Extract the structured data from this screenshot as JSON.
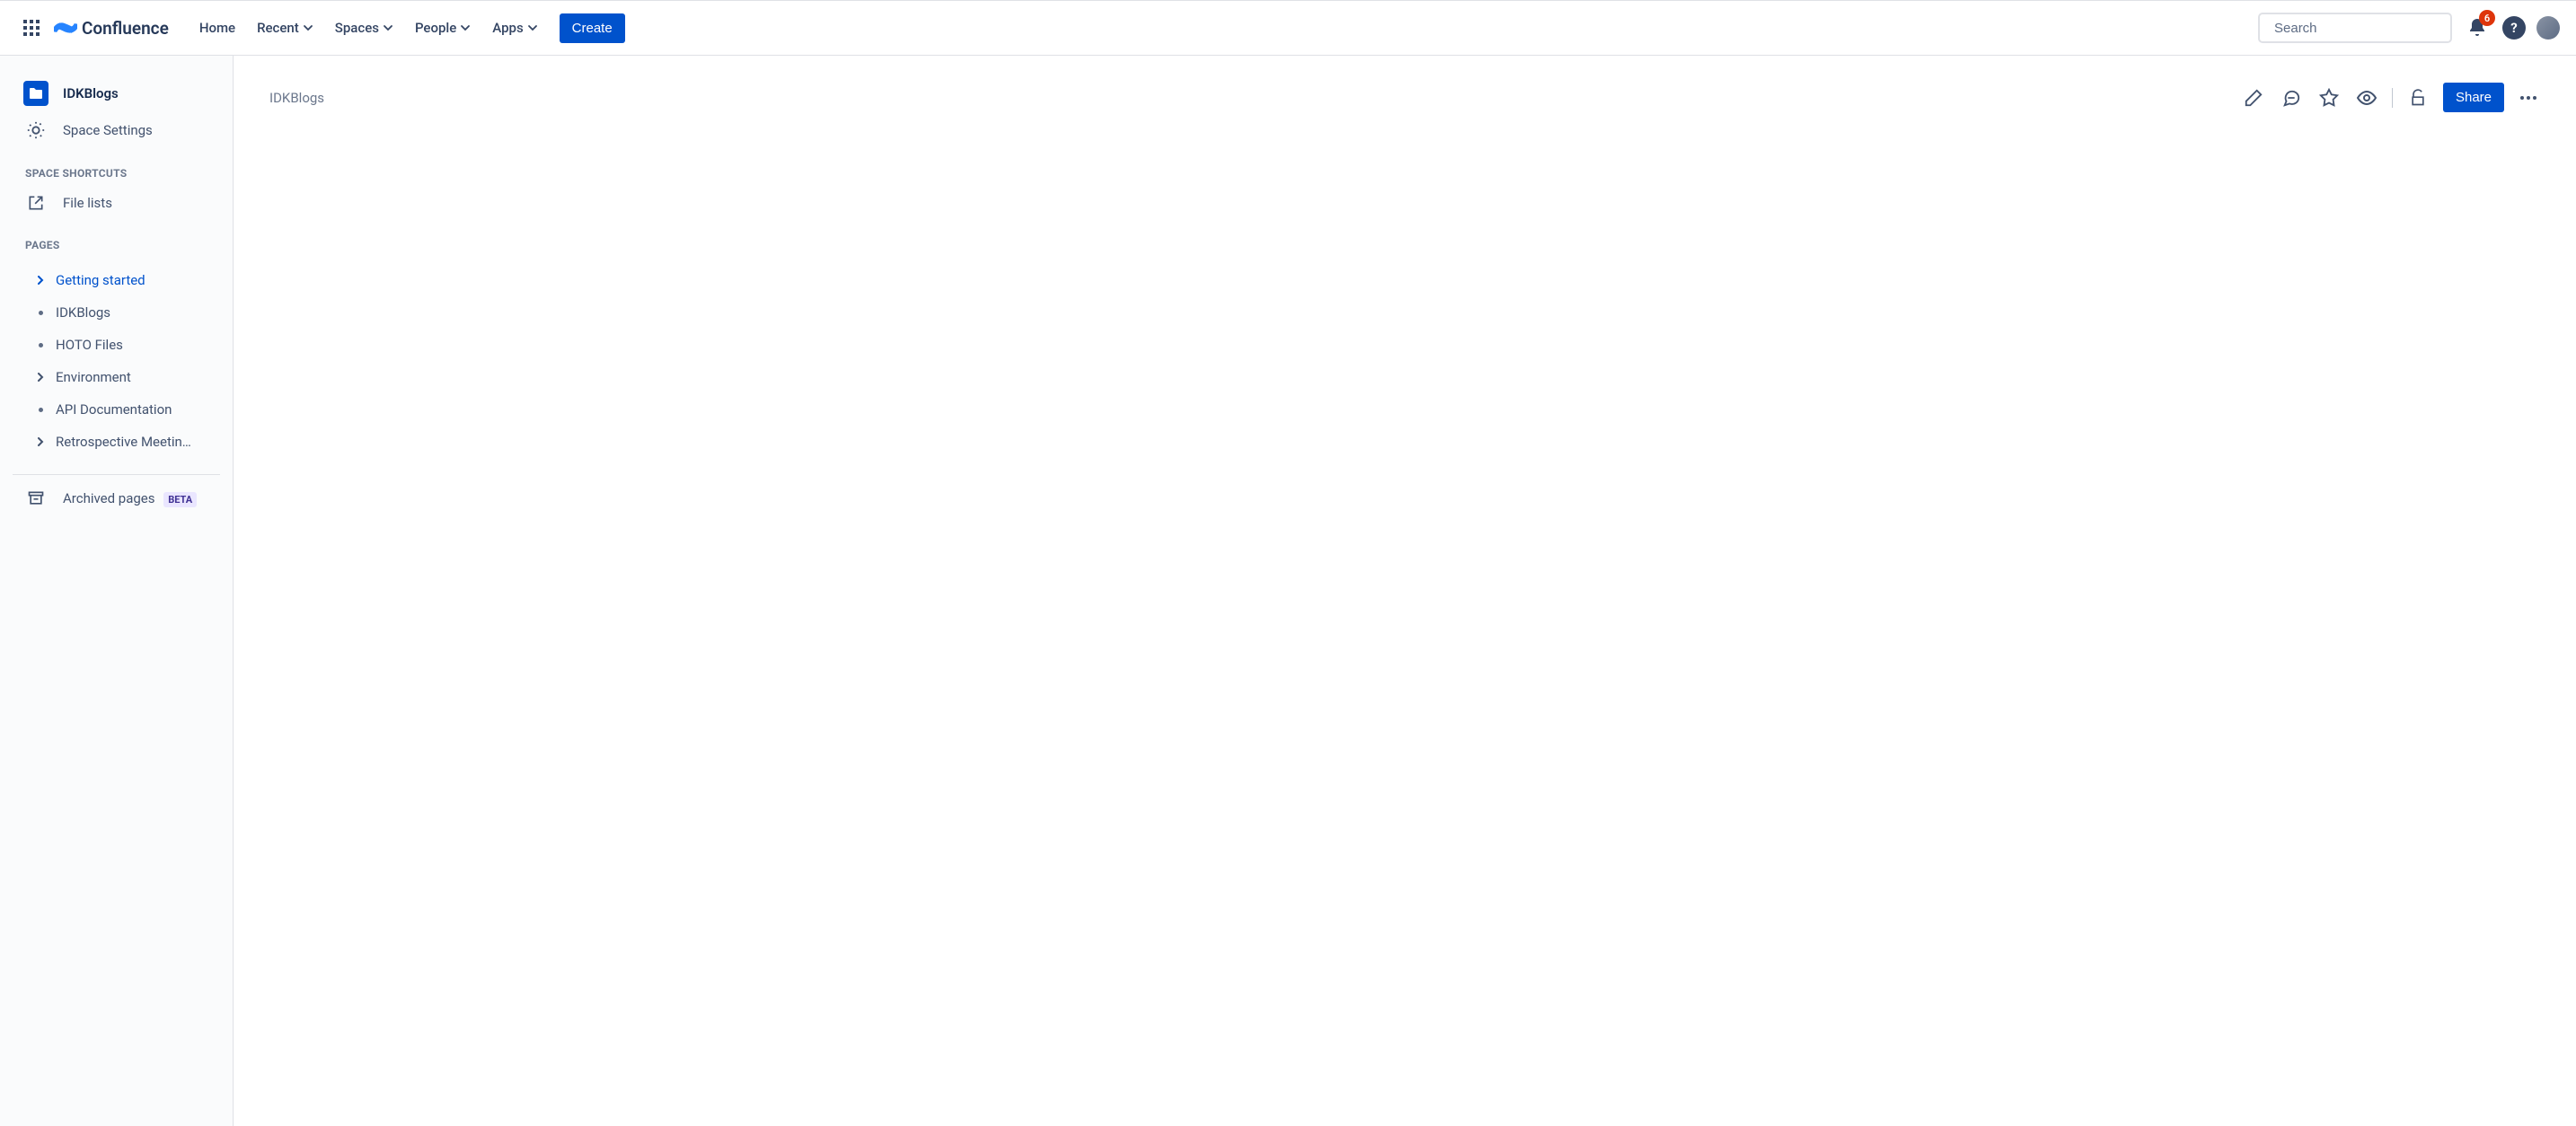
{
  "header": {
    "logo_text": "Confluence",
    "nav": {
      "home": "Home",
      "recent": "Recent",
      "spaces": "Spaces",
      "people": "People",
      "apps": "Apps"
    },
    "create_label": "Create",
    "search_placeholder": "Search",
    "notif_count": "6",
    "help_label": "?"
  },
  "sidebar": {
    "space_title": "IDKBlogs",
    "settings_label": "Space Settings",
    "sections": {
      "shortcuts_header": "SPACE SHORTCUTS",
      "shortcuts": {
        "file_lists": "File lists"
      },
      "pages_header": "PAGES"
    },
    "pages": [
      {
        "label": "Getting started",
        "type": "expandable",
        "selected": true
      },
      {
        "label": "IDKBlogs",
        "type": "leaf",
        "selected": false
      },
      {
        "label": "HOTO Files",
        "type": "leaf",
        "selected": false
      },
      {
        "label": "Environment",
        "type": "expandable",
        "selected": false
      },
      {
        "label": "API Documentation",
        "type": "leaf",
        "selected": false
      },
      {
        "label": "Retrospective Meetin…",
        "type": "expandable",
        "selected": false
      }
    ],
    "archived_label": "Archived pages",
    "beta_label": "BETA"
  },
  "content": {
    "breadcrumb": "IDKBlogs",
    "share_label": "Share"
  }
}
